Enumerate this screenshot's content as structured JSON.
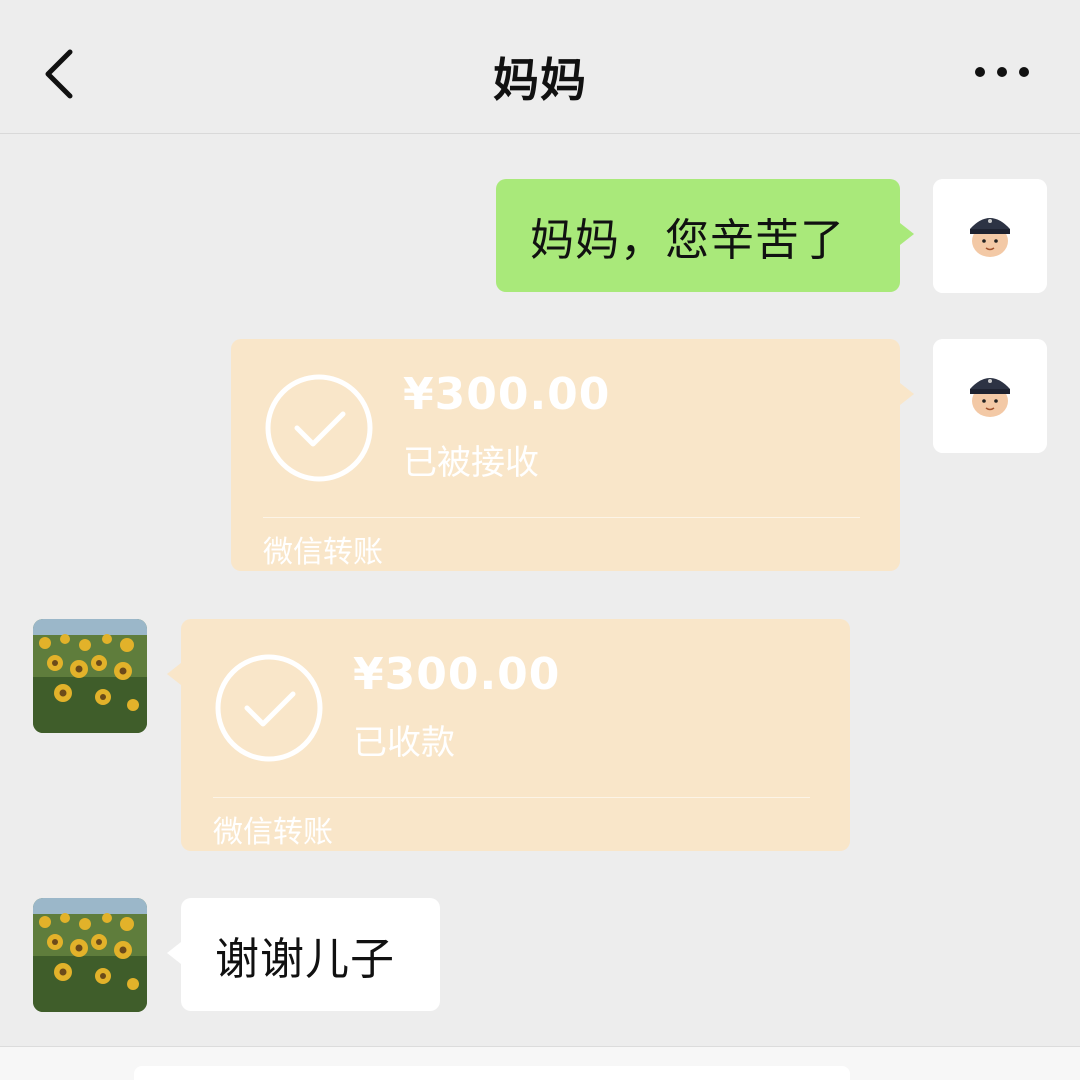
{
  "header": {
    "title": "妈妈",
    "back_icon": "chevron-left-icon",
    "more_icon": "more-horizontal-icon"
  },
  "messages": [
    {
      "from": "me",
      "type": "text",
      "text": "妈妈，您辛苦了"
    },
    {
      "from": "me",
      "type": "transfer",
      "amount": "¥300.00",
      "status": "已被接收",
      "source": "微信转账"
    },
    {
      "from": "mom",
      "type": "transfer",
      "amount": "¥300.00",
      "status": "已收款",
      "source": "微信转账"
    },
    {
      "from": "mom",
      "type": "text",
      "text": "谢谢儿子"
    }
  ],
  "colors": {
    "background": "#ededed",
    "my_bubble": "#a9e97a",
    "her_bubble": "#ffffff",
    "transfer_card": "#f9e6c9"
  },
  "avatars": {
    "me": "cartoon-boy-avatar",
    "mom": "sunflower-field-avatar"
  }
}
